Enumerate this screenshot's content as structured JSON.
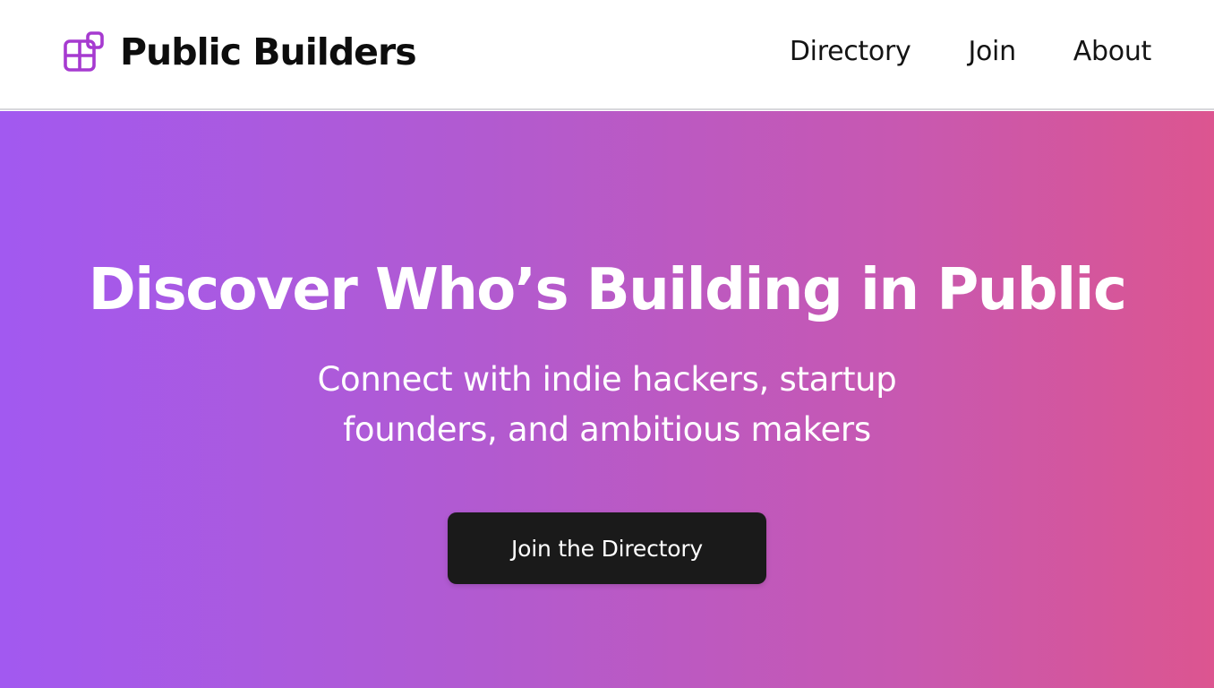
{
  "header": {
    "brand_name": "Public Builders",
    "logo_icon": "blocks-icon",
    "logo_color": "#a63ad0",
    "nav": [
      {
        "label": "Directory"
      },
      {
        "label": "Join"
      },
      {
        "label": "About"
      }
    ]
  },
  "hero": {
    "title": "Discover Who’s Building in Public",
    "subtitle": "Connect with indie hackers, startup founders, and ambitious makers",
    "cta_label": "Join the Directory",
    "gradient_start": "#a259f0",
    "gradient_end": "#dc5590",
    "cta_color": "#1a1a1a"
  }
}
